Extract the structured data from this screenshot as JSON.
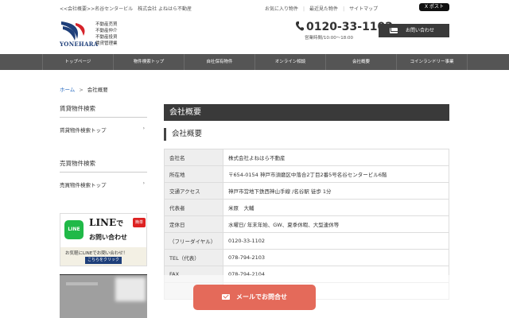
{
  "header": {
    "breadcrumb_text": "<<会社概要>>名谷センタービル　株式会社 よねはら不動産",
    "links": [
      "お気に入り物件",
      "最近見た物件",
      "サイトマップ"
    ],
    "xpost_label": "X ポスト",
    "logo_text": "YONEHARA",
    "logo_tags": [
      "不動産売買",
      "不動産仲介",
      "不動産投資",
      "賃貸管理業"
    ],
    "phone": "0120-33-1102",
    "hours": "営業時間/10:00～18:00",
    "contact_label": "お問い合わせ"
  },
  "nav": {
    "items": [
      "トップページ",
      "物件検索トップ",
      "自社保有物件",
      "オンライン相談",
      "会社概要",
      "コインランドリー事業"
    ]
  },
  "crumb": {
    "home": "ホーム",
    "arrow": ">",
    "current": "会社概要"
  },
  "sidebar": {
    "sections": [
      {
        "heading": "賃貸物件検索",
        "link": "賃貸物件検索トップ"
      },
      {
        "heading": "売買物件検索",
        "link": "売買物件検索トップ"
      }
    ],
    "chevron": "›",
    "line_banner": {
      "logo": "LINE",
      "title_a": "LINE",
      "title_b": "で",
      "badge": "簡単",
      "subtitle": "お問い合わせ",
      "message": "お気軽にLINEでお問い合わせ！",
      "click_label": "こちらをクリック ＞"
    }
  },
  "main": {
    "title": "会社概要",
    "subtitle": "会社概要",
    "rows": [
      {
        "key": "会社名",
        "value": "株式会社よねはら不動産"
      },
      {
        "key": "所在地",
        "value": "〒654-0154 神戸市須磨区中落合2丁目2番5号名谷センタービル6階"
      },
      {
        "key": "交通アクセス",
        "value": "神戸市営地下鉄西神山手線 /名谷駅 徒歩 1分"
      },
      {
        "key": "代表者",
        "value": "米原　大輔"
      },
      {
        "key": "定休日",
        "value": "水曜日/ 年末年始、GW、夏季休暇、大型連休等"
      },
      {
        "key": "（フリーダイヤル）",
        "value": "0120-33-1102"
      },
      {
        "key": "TEL（代表）",
        "value": "078-794-2103"
      },
      {
        "key": "FAX",
        "value": "078-794-2104"
      },
      {
        "key": "",
        "value": ""
      }
    ]
  },
  "cta": {
    "label": "メールでお問合せ"
  },
  "colors": {
    "nav_bg": "#555555",
    "title_bg": "#3a3a3a",
    "cta_bg": "#e46a5a",
    "line_green": "#20b948",
    "logo_blue": "#1e3f7a",
    "logo_red": "#d6232a"
  }
}
